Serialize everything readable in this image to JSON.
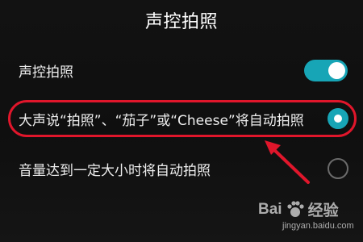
{
  "header": {
    "title": "声控拍照"
  },
  "settings": {
    "voice_toggle": {
      "label": "声控拍照",
      "state": "on"
    },
    "option_keyword": {
      "label": "大声说“拍照”、“茄子”或“Cheese”将自动拍照",
      "selected": true
    },
    "option_volume": {
      "label": "音量达到一定大小时将自动拍照",
      "selected": false
    }
  },
  "annotation": {
    "highlight_color": "#e0162b",
    "arrow_color": "#e0162b"
  },
  "watermark": {
    "brand": "Bai",
    "brand_suffix": "经验",
    "url": "jingyan.baidu.com"
  },
  "colors": {
    "accent": "#17a5b6",
    "background": "#101010",
    "text": "#eeeeee"
  }
}
